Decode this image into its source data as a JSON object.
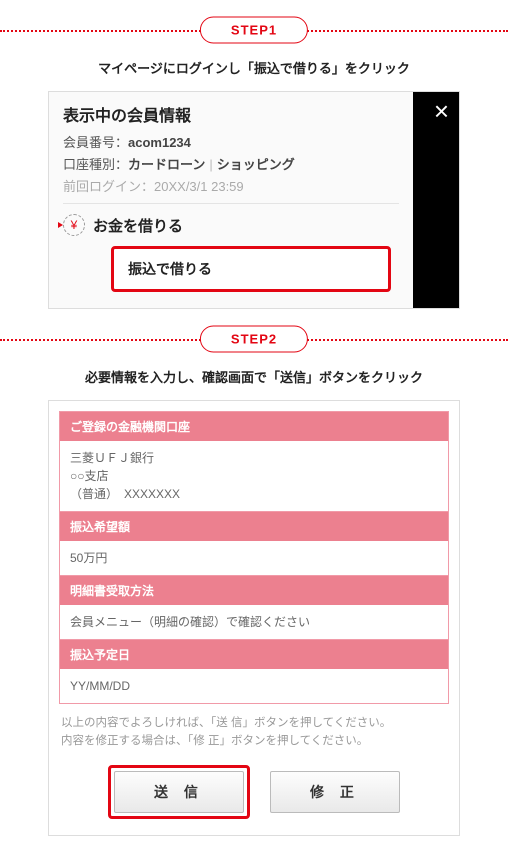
{
  "step1": {
    "badge": "STEP1",
    "caption": "マイページにログインし「振込で借りる」をクリック",
    "card": {
      "title": "表示中の会員情報",
      "member_no_label": "会員番号：",
      "member_no": "acom1234",
      "account_type_label": "口座種別：",
      "account_type_1": "カードローン",
      "account_type_2": "ショッピング",
      "last_login_label": "前回ログイン：",
      "last_login": "20XX/3/1 23:59",
      "borrow_section": "お金を借りる",
      "transfer_button": "振込で借りる",
      "close": "×"
    }
  },
  "step2": {
    "badge": "STEP2",
    "caption": "必要情報を入力し、確認画面で「送信」ボタンをクリック",
    "form": {
      "h1": "ご登録の金融機関口座",
      "v1": "三菱ＵＦＪ銀行\n○○支店\n（普通）　XXXXXXX",
      "h2": "振込希望額",
      "v2": "50万円",
      "h3": "明細書受取方法",
      "v3": "会員メニュー（明細の確認）で確認ください",
      "h4": "振込予定日",
      "v4": "YY/MM/DD"
    },
    "disclaimer": "以上の内容でよろしければ、「送 信」ボタンを押してください。\n内容を修正する場合は、「修 正」ボタンを押してください。",
    "submit": "送 信",
    "modify": "修 正"
  }
}
